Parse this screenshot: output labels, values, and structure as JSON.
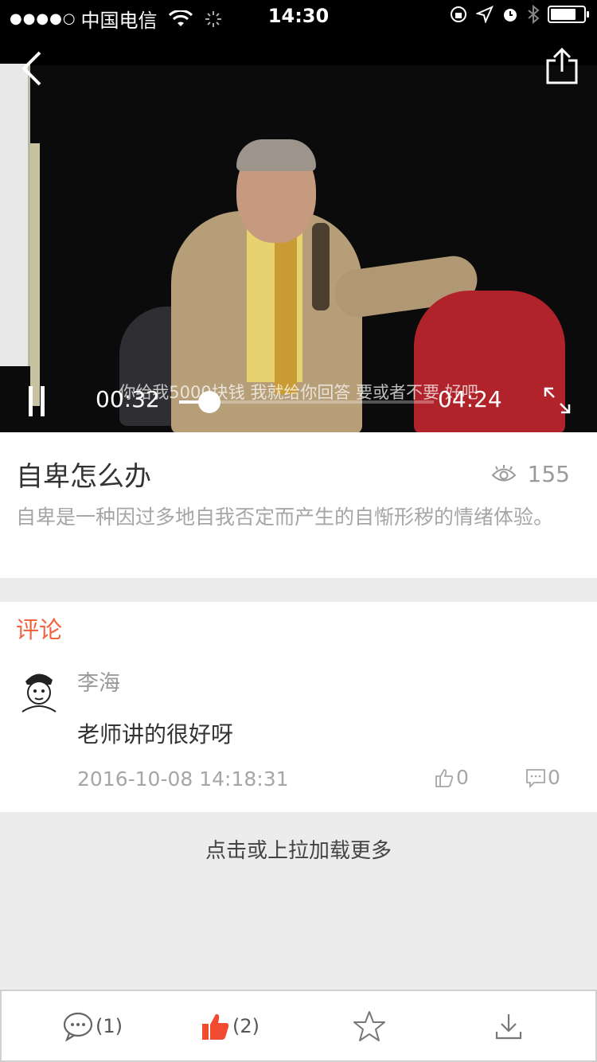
{
  "status_bar": {
    "signal": "●●●●○",
    "carrier": "中国电信",
    "time": "14:30",
    "battery_level": 0.8
  },
  "video": {
    "subtitle": "你给我5000块钱 我就给你回答 要或者不要 好吧",
    "current_time": "00:32",
    "total_time": "04:24",
    "progress": 0.12,
    "icons": {
      "back": "back-arrow-icon",
      "share": "share-icon",
      "pause": "pause-icon",
      "fullscreen": "fullscreen-icon"
    }
  },
  "info": {
    "title": "自卑怎么办",
    "views": "155",
    "description": "自卑是一种因过多地自我否定而产生的自惭形秽的情绪体验。"
  },
  "comments": {
    "heading": "评论",
    "items": [
      {
        "author": "李海",
        "text": "老师讲的很好呀",
        "time": "2016-10-08 14:18:31",
        "likes": "0",
        "replies": "0"
      }
    ]
  },
  "load_more": "点击或上拉加载更多",
  "bottom_bar": {
    "comment_count": "(1)",
    "like_count": "(2)"
  },
  "colors": {
    "accent": "#f0643f",
    "like_active": "#f04a30"
  }
}
